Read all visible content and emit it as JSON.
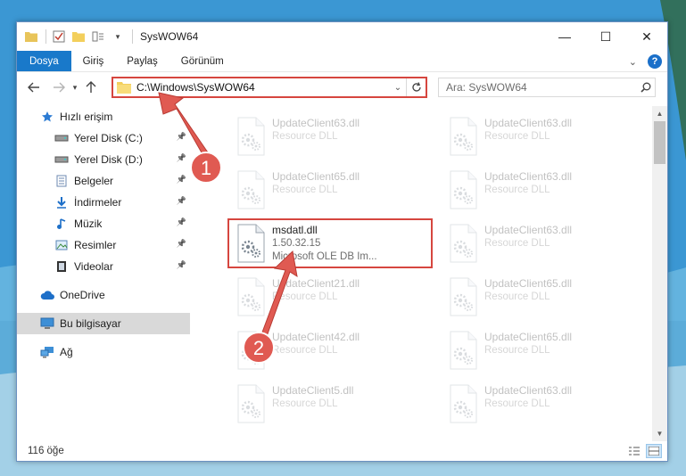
{
  "window": {
    "title": "SysWOW64",
    "controls": {
      "minimize": "—",
      "maximize": "☐",
      "close": "✕"
    }
  },
  "ribbon": {
    "tabs": [
      "Dosya",
      "Giriş",
      "Paylaş",
      "Görünüm"
    ],
    "expand_icon": "chevron-down-icon",
    "help_label": "?"
  },
  "navigation": {
    "address": "C:\\Windows\\SysWOW64",
    "search_placeholder": "Ara: SysWOW64"
  },
  "nav_pane": {
    "quick_access": "Hızlı erişim",
    "quick_items": [
      {
        "label": "Yerel Disk (C:)",
        "icon": "drive-icon"
      },
      {
        "label": "Yerel Disk (D:)",
        "icon": "drive-icon"
      },
      {
        "label": "Belgeler",
        "icon": "documents-icon"
      },
      {
        "label": "İndirmeler",
        "icon": "download-icon"
      },
      {
        "label": "Müzik",
        "icon": "music-icon"
      },
      {
        "label": "Resimler",
        "icon": "pictures-icon"
      },
      {
        "label": "Videolar",
        "icon": "videos-icon"
      }
    ],
    "onedrive": "OneDrive",
    "this_pc": "Bu bilgisayar",
    "network": "Ağ"
  },
  "files": {
    "left_column": [
      {
        "name": "UpdateClient63.dll",
        "type": "Resource DLL"
      },
      {
        "name": "UpdateClient65.dll",
        "type": "Resource DLL"
      },
      {
        "name": "msdatl.dll",
        "version": "1.50.32.15",
        "description": "Microsoft OLE DB Im..."
      },
      {
        "name": "UpdateClient21.dll",
        "type": "Resource DLL"
      },
      {
        "name": "UpdateClient42.dll",
        "type": "Resource DLL"
      },
      {
        "name": "UpdateClient5.dll",
        "type": "Resource DLL"
      }
    ],
    "right_column": [
      {
        "name": "UpdateClient63.dll",
        "type": "Resource DLL"
      },
      {
        "name": "UpdateClient63.dll",
        "type": "Resource DLL"
      },
      {
        "name": "UpdateClient63.dll",
        "type": "Resource DLL"
      },
      {
        "name": "UpdateClient65.dll",
        "type": "Resource DLL"
      },
      {
        "name": "UpdateClient65.dll",
        "type": "Resource DLL"
      },
      {
        "name": "UpdateClient63.dll",
        "type": "Resource DLL"
      }
    ]
  },
  "status": {
    "item_count": "116 öğe"
  },
  "annotations": {
    "step1": "1",
    "step2": "2"
  },
  "colors": {
    "accent": "#1979ca",
    "highlight": "#d6463f"
  }
}
